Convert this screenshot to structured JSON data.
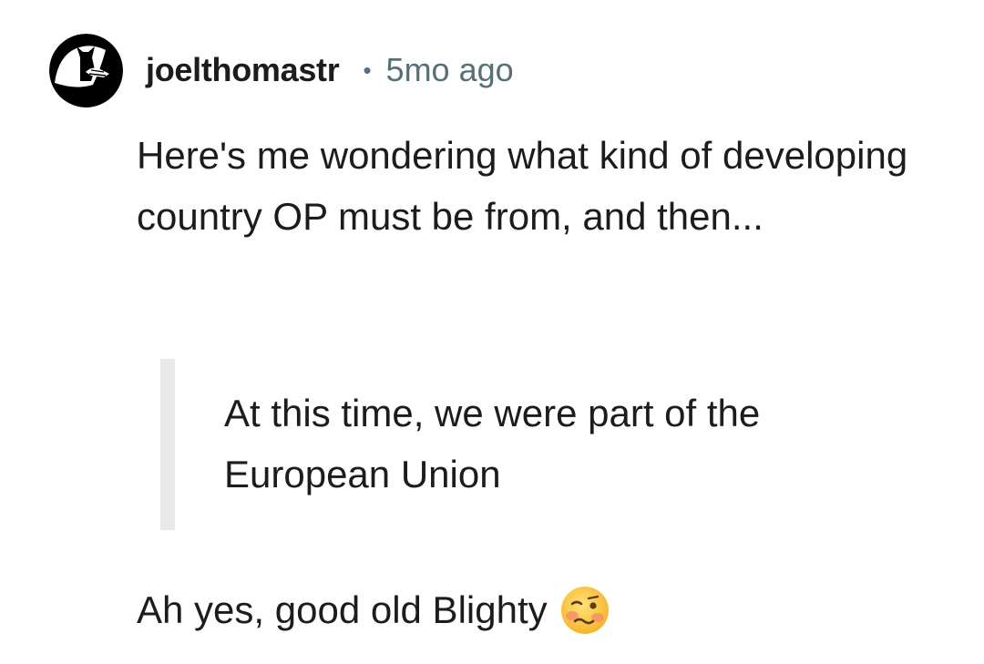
{
  "comment": {
    "avatar_icon": "cat-silhouette-avatar-icon",
    "username": "joelthomastr",
    "separator": "•",
    "timestamp": "5mo ago",
    "paragraph_1": "Here's me wondering what kind of developing country OP must be from, and then...",
    "quote": "At this time, we were part of the European Union",
    "paragraph_2": "Ah yes, good old Blighty",
    "emoji_icon": "woozy-face-emoji-icon"
  },
  "colors": {
    "text": "#1c1c1c",
    "meta_text": "#576f76",
    "quote_bar": "#e9e9e9",
    "background": "#ffffff"
  }
}
